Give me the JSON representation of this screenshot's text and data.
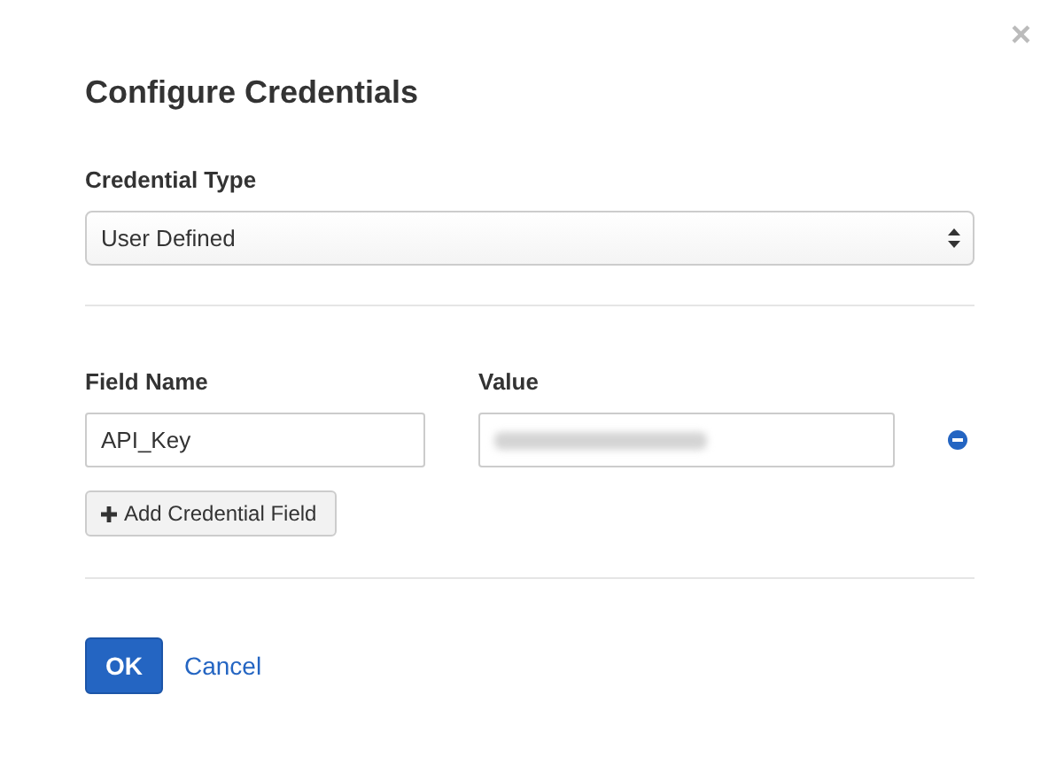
{
  "dialog": {
    "title": "Configure Credentials",
    "close": "×"
  },
  "credential_type": {
    "label": "Credential Type",
    "value": "User Defined"
  },
  "fields": {
    "name_label": "Field Name",
    "value_label": "Value",
    "rows": [
      {
        "name": "API_Key",
        "value_masked": true
      }
    ]
  },
  "add_button": "Add Credential Field",
  "buttons": [
    {
      "kind": "primary",
      "label": "OK"
    },
    {
      "kind": "link",
      "label": "Cancel"
    }
  ]
}
